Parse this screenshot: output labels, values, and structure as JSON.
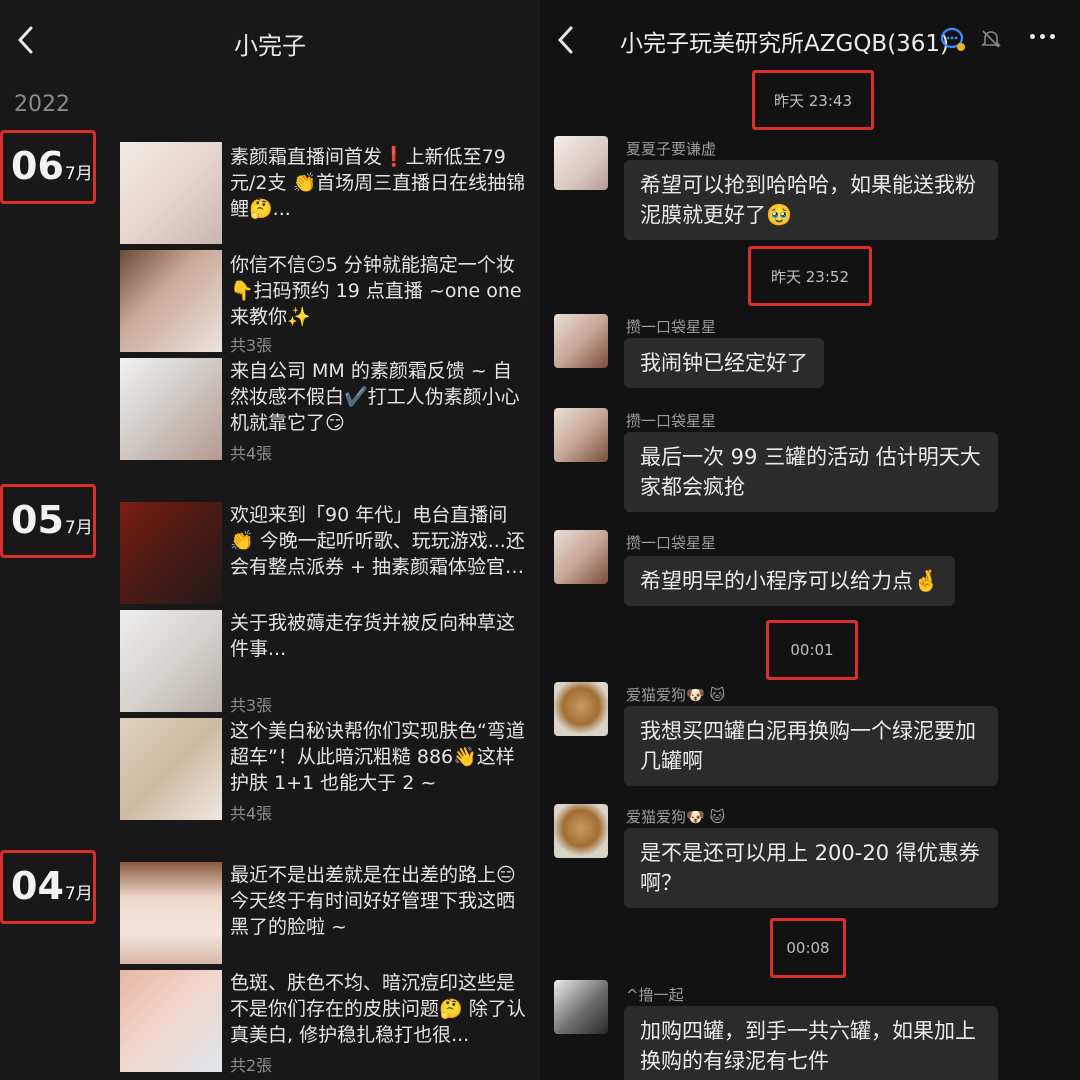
{
  "left": {
    "title": "小完子",
    "year": "2022",
    "groups": [
      {
        "day": "06",
        "month": "7月"
      },
      {
        "day": "05",
        "month": "7月"
      },
      {
        "day": "04",
        "month": "7月"
      }
    ],
    "entries": [
      {
        "text": "素颜霜直播间首发❗上新低至79元/2支\n👏首场周三直播日在线抽锦鲤🤔...",
        "count": ""
      },
      {
        "text": "你信不信😏5 分钟就能搞定一个妆\n👇扫码预约 19 点直播 ~one one 来教你✨",
        "count": "共3張"
      },
      {
        "text": "来自公司 MM 的素颜霜反馈 ~\n自然妆感不假白✔️打工人伪素颜小心机就靠它了😏",
        "count": "共4張"
      },
      {
        "text": "欢迎来到「90 年代」电台直播间👏\n今晚一起听听歌、玩玩游戏...还会有整点派券 + 抽素颜霜体验官哦🤪...",
        "count": ""
      },
      {
        "text": "关于我被薅走存货并被反向种草这件事...",
        "count": "共3張"
      },
      {
        "text": "这个美白秘诀帮你们实现肤色“弯道超车”！从此暗沉粗糙 886👋这样护肤 1+1 也能大于 2 ~",
        "count": "共4張"
      },
      {
        "text": "最近不是出差就是在出差的路上😑\n今天终于有时间好好管理下我这晒黑了的脸啦 ~",
        "count": ""
      },
      {
        "text": "色斑、肤色不均、暗沉痘印这些是不是你们存在的皮肤问题🤔\n除了认真美白, 修护稳扎稳打也很...",
        "count": "共2張"
      }
    ]
  },
  "right": {
    "title": "小完子玩美研究所AZGQB(361)",
    "timestamps": [
      "昨天 23:43",
      "昨天 23:52",
      "00:01",
      "00:08"
    ],
    "messages": [
      {
        "nick": "夏夏子要谦虚",
        "text": "希望可以抢到哈哈哈，如果能送我粉泥膜就更好了🥹"
      },
      {
        "nick": "攒一口袋星星",
        "text": "我闹钟已经定好了"
      },
      {
        "nick": "攒一口袋星星",
        "text": "最后一次 99 三罐的活动 估计明天大家都会疯抢"
      },
      {
        "nick": "攒一口袋星星",
        "text": "希望明早的小程序可以给力点🤞"
      },
      {
        "nick": "爱猫爱狗🐶 🐱",
        "text": "我想买四罐白泥再换购一个绿泥要加几罐啊"
      },
      {
        "nick": "爱猫爱狗🐶 🐱",
        "text": "是不是还可以用上 200-20 得优惠券啊？"
      },
      {
        "nick": "^撸一起",
        "text": "加购四罐，到手一共六罐，如果加上换购的有绿泥有七件"
      }
    ]
  }
}
